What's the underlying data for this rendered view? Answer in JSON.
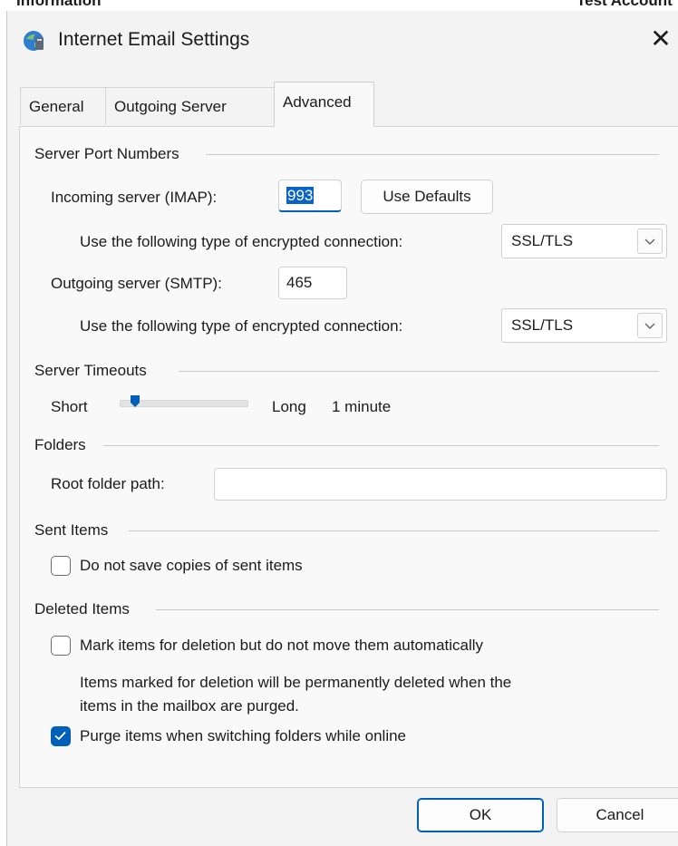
{
  "background_window": {
    "left_text": "Information",
    "right_text": "Test Account"
  },
  "dialog": {
    "title": "Internet Email Settings",
    "close_glyph": "✕",
    "tabs": [
      {
        "label": "General",
        "active": false
      },
      {
        "label": "Outgoing Server",
        "active": false
      },
      {
        "label": "Advanced",
        "active": true
      }
    ]
  },
  "server_ports": {
    "group_label": "Server Port Numbers",
    "incoming_label": "Incoming server (IMAP):",
    "incoming_value": "993",
    "use_defaults_label": "Use Defaults",
    "incoming_encryption_label": "Use the following type of encrypted connection:",
    "incoming_encryption_value": "SSL/TLS",
    "outgoing_label": "Outgoing server (SMTP):",
    "outgoing_value": "465",
    "outgoing_encryption_label": "Use the following type of encrypted connection:",
    "outgoing_encryption_value": "SSL/TLS"
  },
  "server_timeouts": {
    "group_label": "Server Timeouts",
    "short_label": "Short",
    "long_label": "Long",
    "value_label": "1 minute",
    "slider_level": 0.12
  },
  "folders": {
    "group_label": "Folders",
    "root_label": "Root folder path:",
    "root_value": ""
  },
  "sent_items": {
    "group_label": "Sent Items",
    "no_copies_label": "Do not save copies of sent items",
    "no_copies_checked": false
  },
  "deleted_items": {
    "group_label": "Deleted Items",
    "mark_label": "Mark items for deletion but do not move them automatically",
    "mark_checked": false,
    "note_line1": "Items marked for deletion will be permanently deleted when the",
    "note_line2": "items in the mailbox are purged.",
    "purge_label": "Purge items when switching folders while online",
    "purge_checked": true
  },
  "footer": {
    "ok_label": "OK",
    "cancel_label": "Cancel"
  },
  "colors": {
    "accent": "#005fb8",
    "dialog_bg": "#f3f3f3",
    "panel_bg": "#f9f9f9"
  },
  "icons": {
    "app": "outlook-account-icon",
    "close": "close-icon",
    "dropdown": "chevron-down-icon",
    "check": "checkmark-icon"
  }
}
